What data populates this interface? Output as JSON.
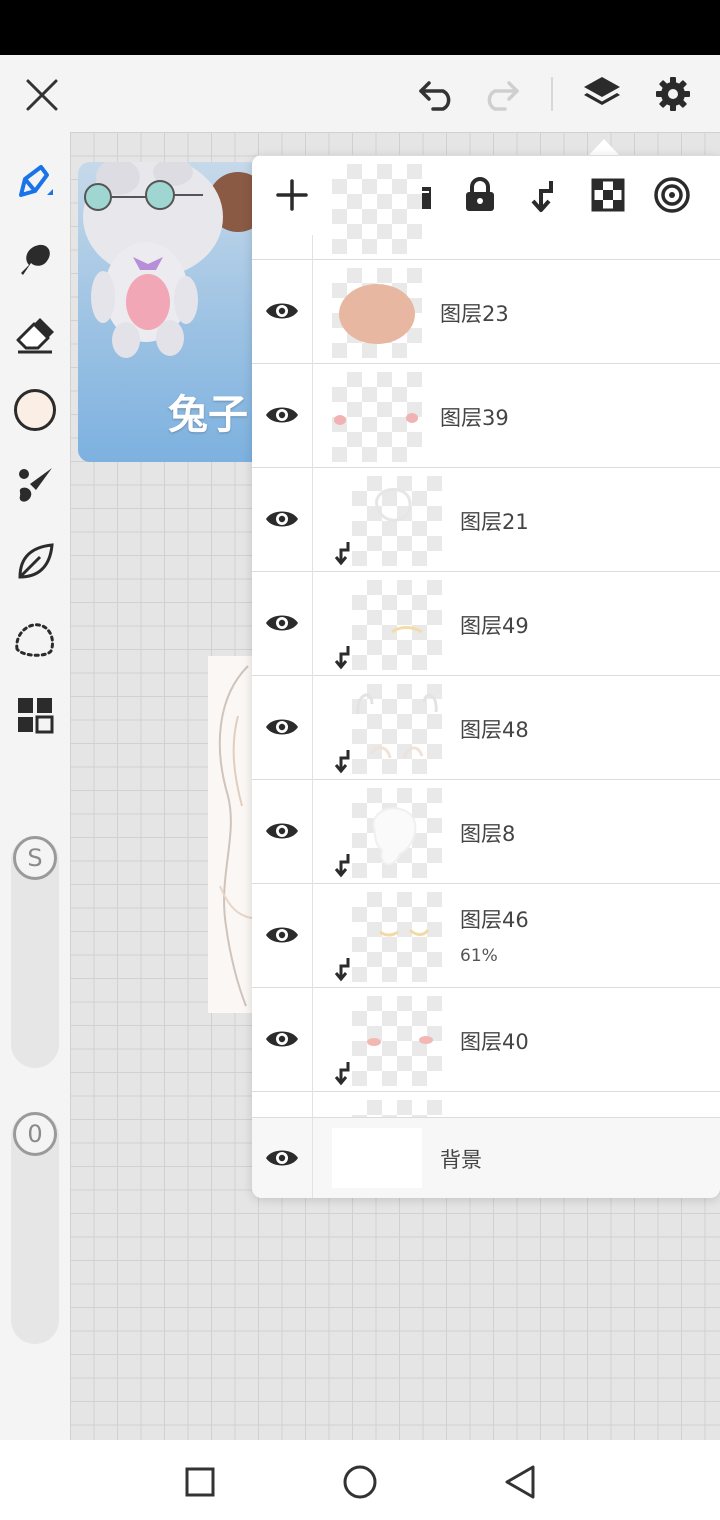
{
  "app": {
    "accent_color": "#1a73e8",
    "current_color": "#fbeee4"
  },
  "top_bar": {
    "icons": [
      "close-icon",
      "undo-icon",
      "redo-icon",
      "layers-icon",
      "gear-icon"
    ]
  },
  "left_toolbar": {
    "tools": [
      "pen-icon",
      "smudge-icon",
      "eraser-icon",
      "color-swatch",
      "brush-icon",
      "leaf-icon",
      "lasso-icon",
      "grid-icon"
    ],
    "size_slider_label": "S",
    "opacity_slider_label": "0"
  },
  "reference": {
    "caption": "兔子"
  },
  "layers_panel": {
    "toolbar_icons": [
      "plus-icon",
      "folder-icon",
      "lock-icon",
      "clip-icon",
      "checker-icon",
      "target-icon"
    ],
    "layers": [
      {
        "name": "图层23",
        "clipped": false,
        "opacity": ""
      },
      {
        "name": "图层39",
        "clipped": false,
        "opacity": ""
      },
      {
        "name": "图层21",
        "clipped": true,
        "opacity": ""
      },
      {
        "name": "图层49",
        "clipped": true,
        "opacity": ""
      },
      {
        "name": "图层48",
        "clipped": true,
        "opacity": ""
      },
      {
        "name": "图层8",
        "clipped": true,
        "opacity": ""
      },
      {
        "name": "图层46",
        "clipped": true,
        "opacity": "61%"
      },
      {
        "name": "图层40",
        "clipped": true,
        "opacity": ""
      }
    ],
    "background_layer": {
      "name": "背景"
    }
  },
  "nav_bar": {
    "icons": [
      "recents-square-icon",
      "home-circle-icon",
      "back-triangle-icon"
    ]
  }
}
